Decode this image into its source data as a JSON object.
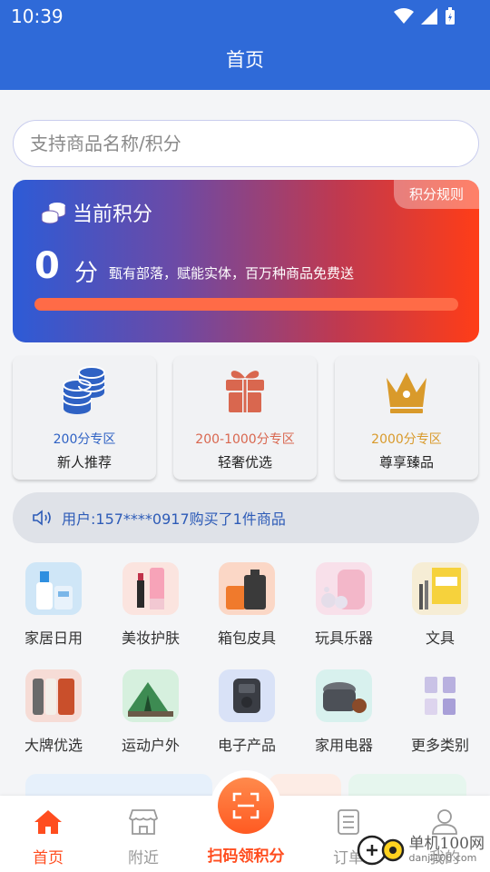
{
  "status_bar": {
    "time": "10:39"
  },
  "nav": {
    "title": "首页"
  },
  "search": {
    "placeholder": "支持商品名称/积分"
  },
  "points_card": {
    "title": "当前积分",
    "rules_label": "积分规则",
    "value": "0",
    "unit": "分",
    "slogan": "甄有部落，赋能实体，百万种商品免费送",
    "progress": 0.0
  },
  "zones": [
    {
      "range": "200分专区",
      "name": "新人推荐",
      "icon": "coins-stack-icon",
      "color": "#2f62c4"
    },
    {
      "range": "200-1000分专区",
      "name": "轻奢优选",
      "icon": "gift-box-icon",
      "color": "#d9674f"
    },
    {
      "range": "2000分专区",
      "name": "尊享臻品",
      "icon": "crown-icon",
      "color": "#d99a2b"
    }
  ],
  "notice": {
    "text": "用户:157****0917购买了1件商品"
  },
  "categories": [
    {
      "label": "家居日用"
    },
    {
      "label": "美妆护肤"
    },
    {
      "label": "箱包皮具"
    },
    {
      "label": "玩具乐器"
    },
    {
      "label": "文具"
    },
    {
      "label": "大牌优选"
    },
    {
      "label": "运动户外"
    },
    {
      "label": "电子产品"
    },
    {
      "label": "家用电器"
    },
    {
      "label": "更多类别"
    }
  ],
  "tabs": [
    {
      "label": "首页"
    },
    {
      "label": "附近"
    },
    {
      "label": "扫码领积分"
    },
    {
      "label": "订单"
    },
    {
      "label": "我的"
    }
  ],
  "watermark": {
    "cn": "单机100网",
    "en": "danji100.com"
  },
  "colors": {
    "brand_blue": "#2f6ad8",
    "accent_orange": "#ff4d1f"
  }
}
